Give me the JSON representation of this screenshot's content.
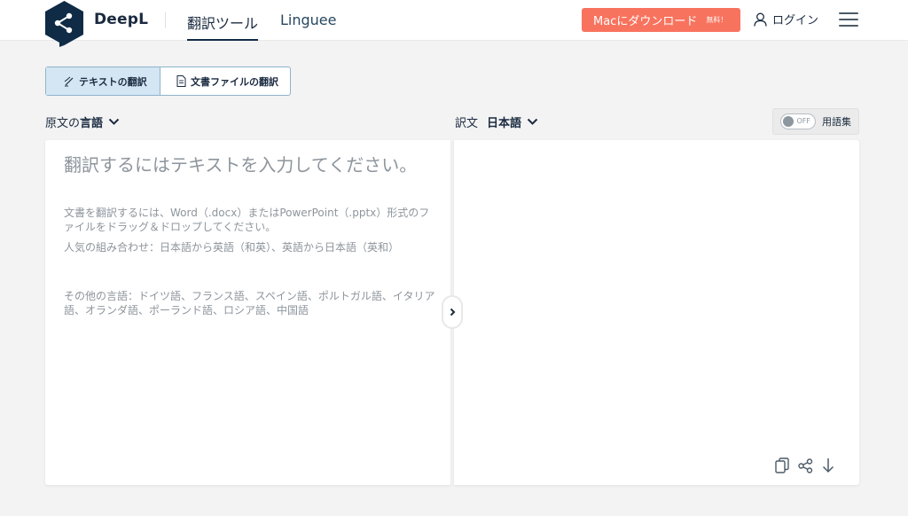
{
  "header": {
    "brand": "DeepL",
    "nav_translator": "翻訳ツール",
    "nav_linguee": "Linguee",
    "mac_button": "Macにダウンロード",
    "mac_button_badge": "無料！",
    "login": "ログイン"
  },
  "mode_tabs": {
    "text": "テキストの翻訳",
    "document": "文書ファイルの翻訳"
  },
  "source": {
    "lang_prefix": "原文の",
    "lang_label": "言語",
    "placeholder": "翻訳するにはテキストを入力してください。",
    "hint_files": "文書を翻訳するには、Word（.docx）またはPowerPoint（.pptx）形式のファイルをドラッグ＆ドロップしてください。",
    "hint_popular": "人気の組み合わせ：日本語から英語（和英）、英語から日本語（英和）",
    "hint_other": "その他の言語：ドイツ語、フランス語、スペイン語、ポルトガル語、イタリア語、オランダ語、ポーランド語、ロシア語、中国語"
  },
  "target": {
    "lang_prefix": "訳文",
    "lang_label": "日本語",
    "glossary_toggle": "OFF",
    "glossary_label": "用語集"
  },
  "icons": {
    "logo": "deepl-logo",
    "user": "user-icon",
    "menu": "hamburger-icon",
    "swap": "chevron-right-icon",
    "copy": "copy-icon",
    "share": "share-icon",
    "download": "download-icon"
  },
  "colors": {
    "brand_navy": "#0f2b46",
    "mac_button": "#f8735e",
    "active_tab": "#d4e6f3"
  }
}
